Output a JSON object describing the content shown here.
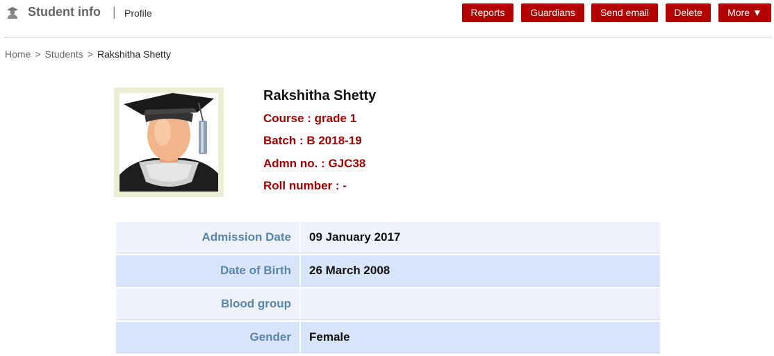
{
  "header": {
    "module_title": "Student info",
    "separator": "|",
    "sub_title": "Profile"
  },
  "actions": {
    "reports": "Reports",
    "guardians": "Guardians",
    "send_email": "Send email",
    "delete": "Delete",
    "more": "More ▼"
  },
  "breadcrumb": {
    "home": "Home",
    "students": "Students",
    "current": "Rakshitha Shetty",
    "separator": ">"
  },
  "student": {
    "name": "Rakshitha Shetty",
    "course": "Course : grade 1",
    "batch": "Batch : B 2018-19",
    "admission_no": "Admn no. : GJC38",
    "roll_number": "Roll number : -"
  },
  "details": [
    {
      "label": "Admission Date",
      "value": "09 January 2017"
    },
    {
      "label": "Date of Birth",
      "value": "26 March 2008"
    },
    {
      "label": "Blood group",
      "value": ""
    },
    {
      "label": "Gender",
      "value": "Female"
    }
  ],
  "colors": {
    "button_bg": "#b30000",
    "info_text": "#a40000",
    "label_text": "#5a84ac",
    "row_light": "#edf2fc",
    "row_dark": "#d8e4fa"
  }
}
